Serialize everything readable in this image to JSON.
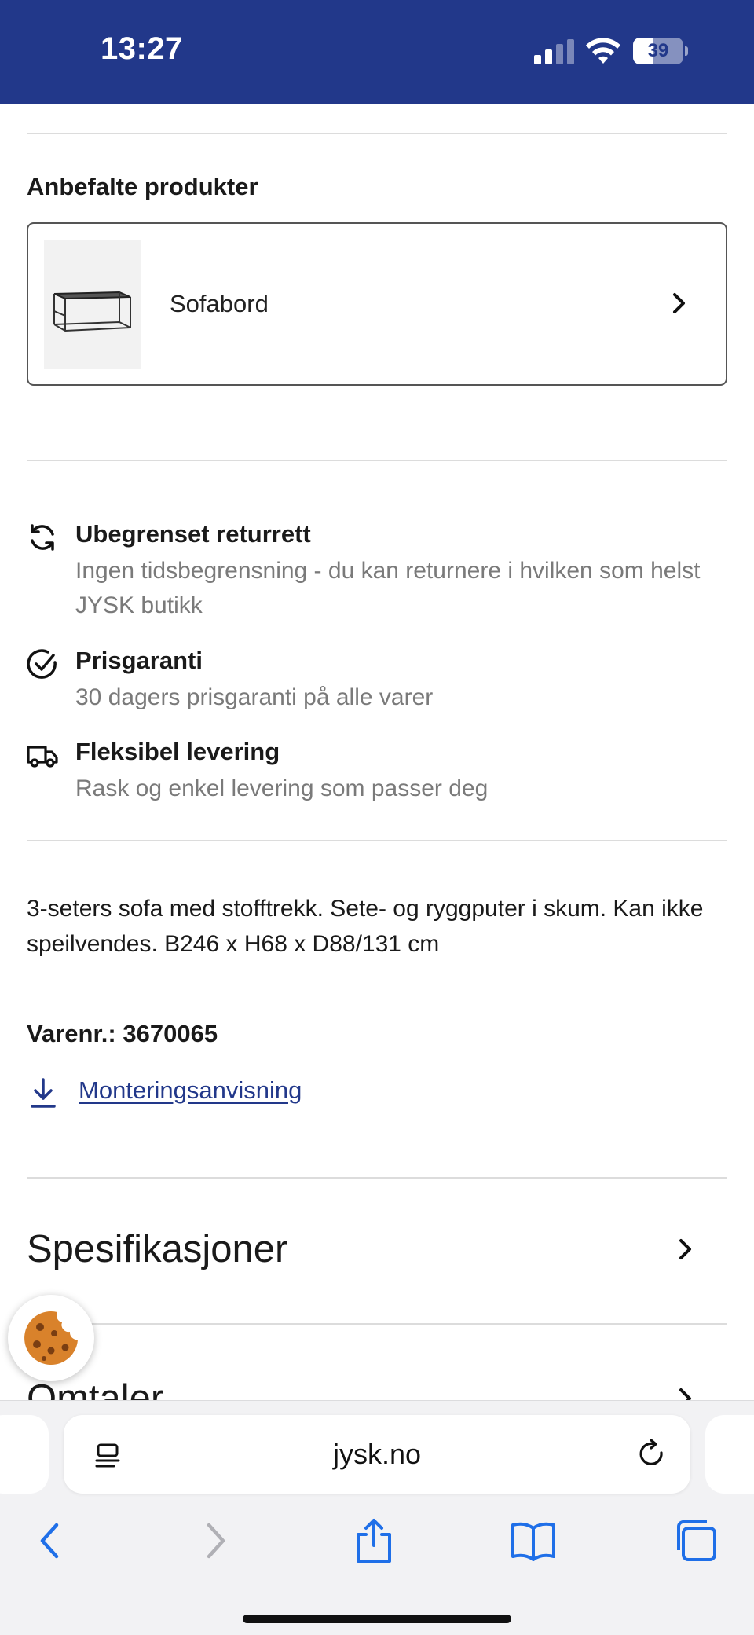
{
  "status_bar": {
    "time": "13:27",
    "battery_level": "39",
    "signal_bars_active": 2,
    "signal_bars_total": 4
  },
  "recommended": {
    "title": "Anbefalte produkter",
    "items": [
      {
        "name": "Sofabord",
        "image": "coffee-table-image",
        "icon": "chevron-right-icon"
      }
    ]
  },
  "usps": [
    {
      "icon": "refresh-icon",
      "title": "Ubegrenset returrett",
      "description": "Ingen tidsbegrensning - du kan returnere i hvilken som helst JYSK butikk"
    },
    {
      "icon": "check-circle-icon",
      "title": "Prisgaranti",
      "description": "30 dagers prisgaranti på alle varer"
    },
    {
      "icon": "truck-icon",
      "title": "Fleksibel levering",
      "description": "Rask og enkel levering som passer deg"
    }
  ],
  "product": {
    "description": "3-seters sofa med stofftrekk. Sete- og ryggputer i skum. Kan ikke speilvendes. B246 x H68 x D88/131 cm",
    "article_label": "Varenr.:",
    "article_number": "3670065",
    "assembly_link": "Monteringsanvisning"
  },
  "accordions": [
    {
      "label": "Spesifikasjoner",
      "icon": "chevron-right-icon"
    },
    {
      "label": "Omtaler",
      "icon": "chevron-right-icon"
    }
  ],
  "browser": {
    "url": "jysk.no",
    "toolbar": [
      "back-icon",
      "forward-icon",
      "share-icon",
      "bookmarks-icon",
      "tabs-icon"
    ]
  },
  "colors": {
    "brand_blue": "#22388a",
    "muted_text": "#7a7a7a",
    "ios_blue": "#1f6fe8",
    "cookie_orange": "#d9822b"
  }
}
